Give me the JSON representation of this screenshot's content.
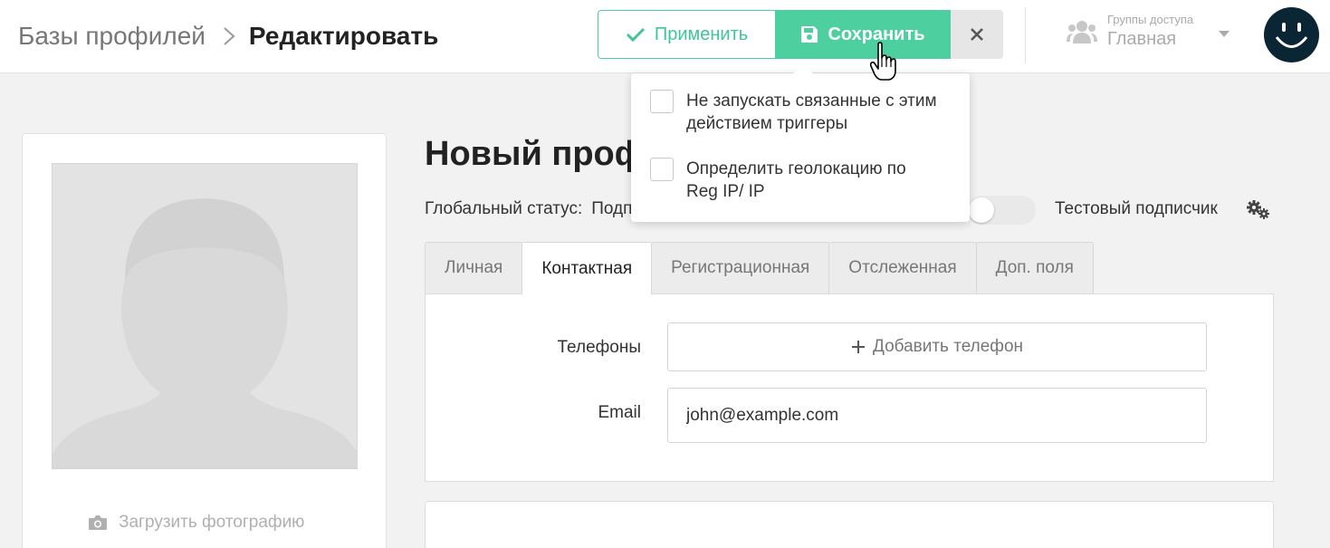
{
  "breadcrumb": {
    "root": "Базы профилей",
    "current": "Редактировать"
  },
  "toolbar": {
    "apply_label": "Применить",
    "save_label": "Сохранить",
    "close_icon": "close-icon"
  },
  "access_group": {
    "label": "Группы доступа",
    "value": "Главная"
  },
  "save_options": [
    {
      "label": "Не запускать связанные с этим действием триггеры",
      "checked": false
    },
    {
      "label": "Определить геолокацию по Reg IP/ IP",
      "checked": false
    }
  ],
  "photo": {
    "upload_label": "Загрузить фотографию"
  },
  "profile": {
    "title": "Новый проф",
    "global_status_label": "Глобальный статус:",
    "global_status_value": "Подп",
    "test_subscriber_label": "Тестовый подписчик",
    "test_subscriber_on": false
  },
  "tabs": [
    {
      "label": "Личная",
      "active": false
    },
    {
      "label": "Контактная",
      "active": true
    },
    {
      "label": "Регистрационная",
      "active": false
    },
    {
      "label": "Отслеженная",
      "active": false
    },
    {
      "label": "Доп. поля",
      "active": false
    }
  ],
  "contact": {
    "phones_label": "Телефоны",
    "add_phone_label": "Добавить телефон",
    "email_label": "Email",
    "email_value": "john@example.com"
  },
  "colors": {
    "accent": "#4ecfa0",
    "avatar_bg": "#0a2533"
  }
}
